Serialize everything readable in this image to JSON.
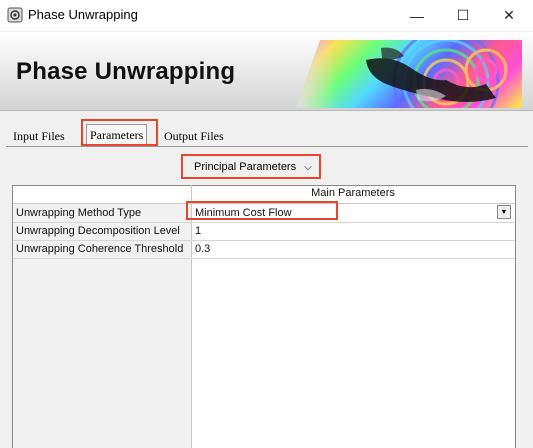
{
  "window": {
    "title": "Phase Unwrapping",
    "controls": {
      "minimize": "—",
      "maximize": "☐",
      "close": "✕"
    }
  },
  "banner": {
    "title": "Phase Unwrapping"
  },
  "tabs": [
    {
      "label": "Input Files",
      "selected": false
    },
    {
      "label": "Parameters",
      "selected": true
    },
    {
      "label": "Output Files",
      "selected": false
    }
  ],
  "parameters": {
    "group_selector": {
      "value": "Principal Parameters",
      "icon": "chevron-down-icon"
    },
    "table": {
      "header": "Main Parameters",
      "rows": [
        {
          "label": "Unwrapping Method Type",
          "value": "Minimum Cost Flow"
        },
        {
          "label": "Unwrapping Decomposition Level",
          "value": "1"
        },
        {
          "label": "Unwrapping Coherence Threshold",
          "value": "0.3"
        }
      ]
    }
  },
  "highlight_color": "#e8452a"
}
